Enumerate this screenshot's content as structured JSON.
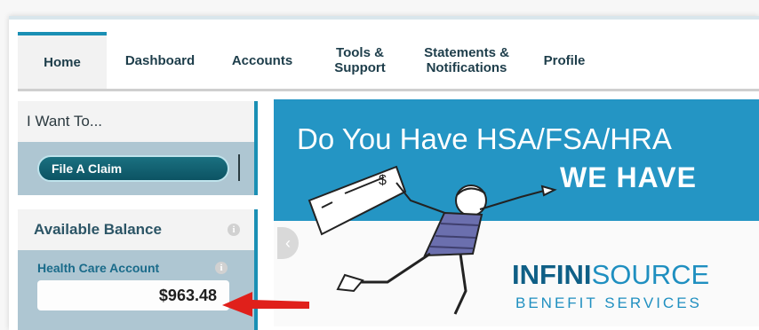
{
  "nav": {
    "tabs": [
      {
        "label": "Home"
      },
      {
        "label": "Dashboard"
      },
      {
        "label": "Accounts"
      },
      {
        "label": "Tools &\nSupport"
      },
      {
        "label": "Statements &\nNotifications"
      },
      {
        "label": "Profile"
      }
    ]
  },
  "sidebar": {
    "want_title": "I Want To...",
    "claim_button": "File A Claim",
    "balance_title": "Available Balance",
    "account_label": "Health Care Account",
    "account_amount": "$963.48",
    "info_glyph": "i"
  },
  "banner": {
    "line1": "Do You Have HSA/FSA/HRA",
    "line2": "WE HAVE",
    "logo_bold": "INFINI",
    "logo_thin": "SOURCE",
    "logo_sub": "BENEFIT SERVICES",
    "prev_glyph": "‹",
    "check_glyph": "$"
  },
  "colors": {
    "accent": "#1a8fb4",
    "banner_blue": "#2495c4",
    "button_teal": "#0c5363",
    "arrow_red": "#e0201b"
  }
}
